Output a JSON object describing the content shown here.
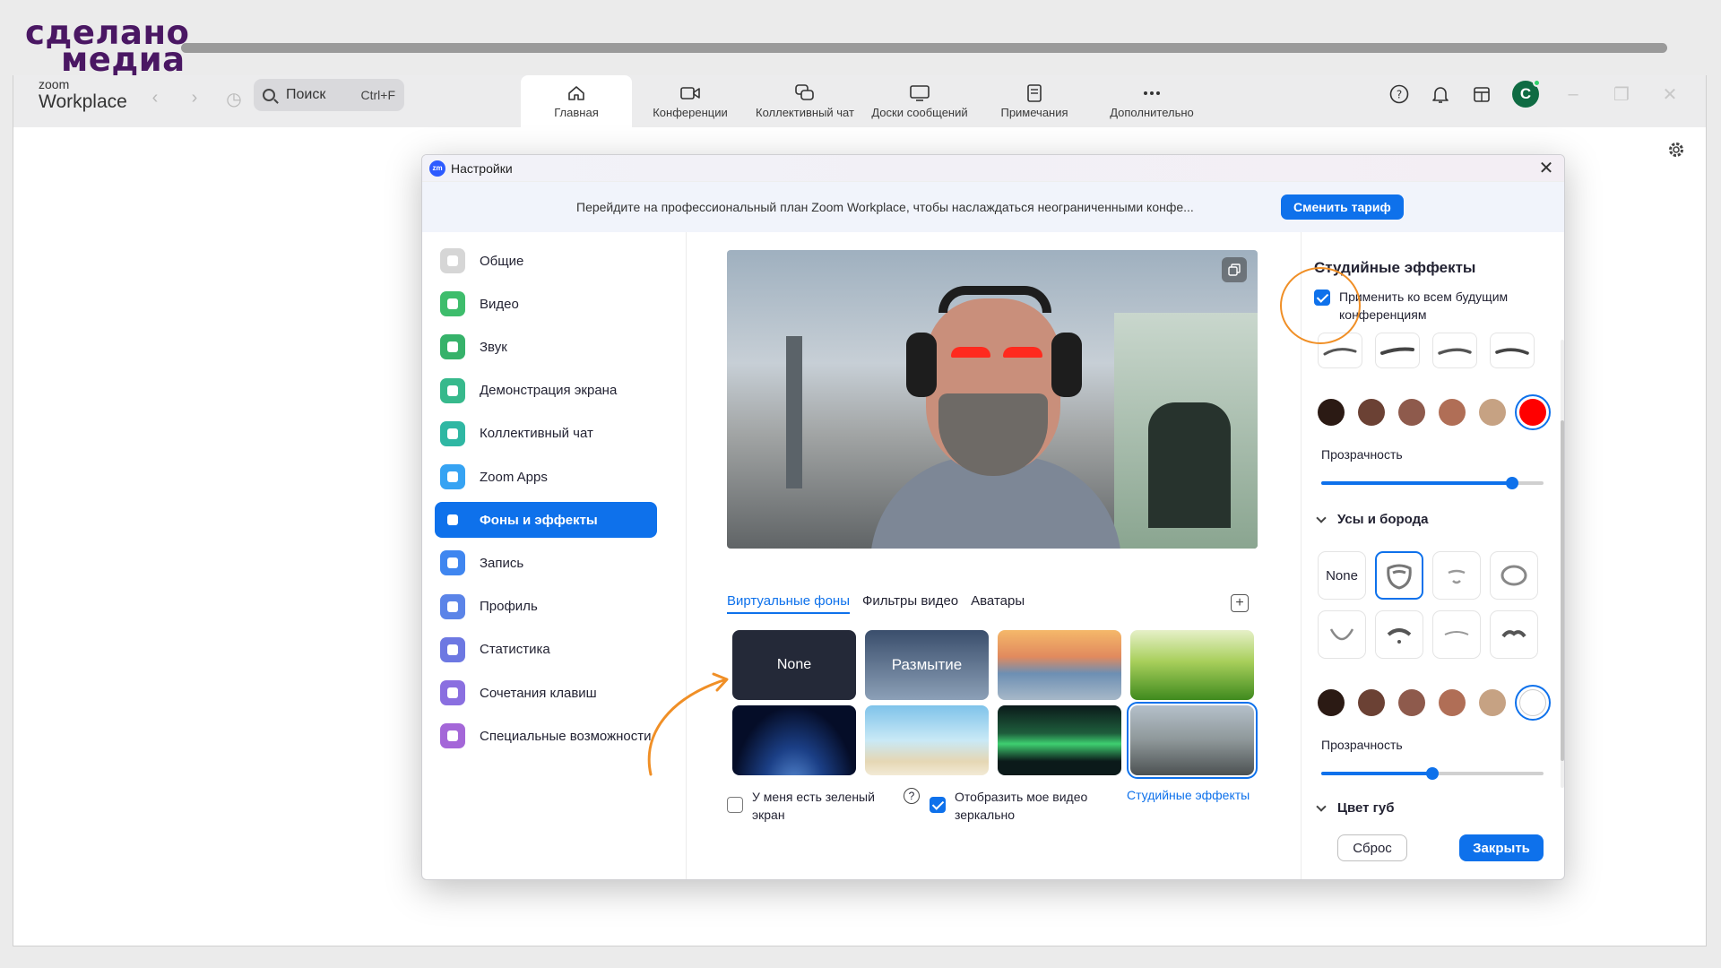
{
  "brand": {
    "line1": "сделано",
    "line2": "медиа",
    "progress": 1.0
  },
  "app": {
    "logo_small": "zoom",
    "logo_name": "Workplace",
    "search": {
      "label": "Поиск",
      "shortcut": "Ctrl+F"
    },
    "tabs": [
      {
        "label": "Главная",
        "icon": "home-icon",
        "active": true
      },
      {
        "label": "Конференции",
        "icon": "video-camera-icon"
      },
      {
        "label": "Коллективный чат",
        "icon": "chat-bubbles-icon"
      },
      {
        "label": "Доски сообщений",
        "icon": "monitor-icon"
      },
      {
        "label": "Примечания",
        "icon": "notes-icon"
      },
      {
        "label": "Дополнительно",
        "icon": "more-dots-icon"
      }
    ],
    "avatar_letter": "С",
    "accent": "#0e71eb"
  },
  "settings": {
    "title": "Настройки",
    "banner": {
      "text": "Перейдите на профессиональный план Zoom Workplace, чтобы наслаждаться неограниченными конфе...",
      "button": "Сменить тариф"
    },
    "sidebar": [
      {
        "label": "Общие",
        "color": "#d6d6d6"
      },
      {
        "label": "Видео",
        "color": "#3ebd6c"
      },
      {
        "label": "Звук",
        "color": "#36b26a"
      },
      {
        "label": "Демонстрация экрана",
        "color": "#37b98c"
      },
      {
        "label": "Коллективный чат",
        "color": "#2fb7a3"
      },
      {
        "label": "Zoom Apps",
        "color": "#36a3f3"
      },
      {
        "label": "Фоны и эффекты",
        "color": "#0e71eb",
        "active": true
      },
      {
        "label": "Запись",
        "color": "#3f86f0"
      },
      {
        "label": "Профиль",
        "color": "#5b84e8"
      },
      {
        "label": "Статистика",
        "color": "#6d78e2"
      },
      {
        "label": "Сочетания клавиш",
        "color": "#8a6fe0"
      },
      {
        "label": "Специальные возможности",
        "color": "#a467d8"
      }
    ],
    "content": {
      "tabs": [
        "Виртуальные фоны",
        "Фильтры видео",
        "Аватары"
      ],
      "backgrounds": [
        {
          "label": "None",
          "kind": "none"
        },
        {
          "label": "Размытие",
          "kind": "blur"
        },
        {
          "label": "",
          "kind": "bridge"
        },
        {
          "label": "",
          "kind": "grass"
        },
        {
          "label": "",
          "kind": "earth"
        },
        {
          "label": "",
          "kind": "beach"
        },
        {
          "label": "",
          "kind": "aurora"
        },
        {
          "label": "",
          "kind": "photo",
          "selected": true
        }
      ],
      "green_screen": "У меня есть зеленый экран",
      "green_screen_checked": false,
      "mirror": "Отобразить мое видео зеркально",
      "mirror_checked": true,
      "studio_link": "Студийные эффекты"
    },
    "studio": {
      "title": "Студийные эффекты",
      "apply_all": "Применить ко всем будущим конференциям",
      "apply_all_checked": true,
      "brow_colors": [
        "#2b1a14",
        "#6b4134",
        "#8e5a4c",
        "#b06e56",
        "#c6a283",
        "#ff0000"
      ],
      "brow_color_selected": 5,
      "brow_opacity_label": "Прозрачность",
      "brow_opacity": 0.86,
      "beard_section": "Усы и борода",
      "beard_none": "None",
      "beard_colors": [
        "#2b1a14",
        "#6b4134",
        "#8e5a4c",
        "#b06e56",
        "#c6a283",
        "#ffffff"
      ],
      "beard_color_selected": 5,
      "beard_opacity_label": "Прозрачность",
      "beard_opacity": 0.5,
      "lips_section": "Цвет губ",
      "reset": "Сброс",
      "close": "Закрыть"
    }
  }
}
